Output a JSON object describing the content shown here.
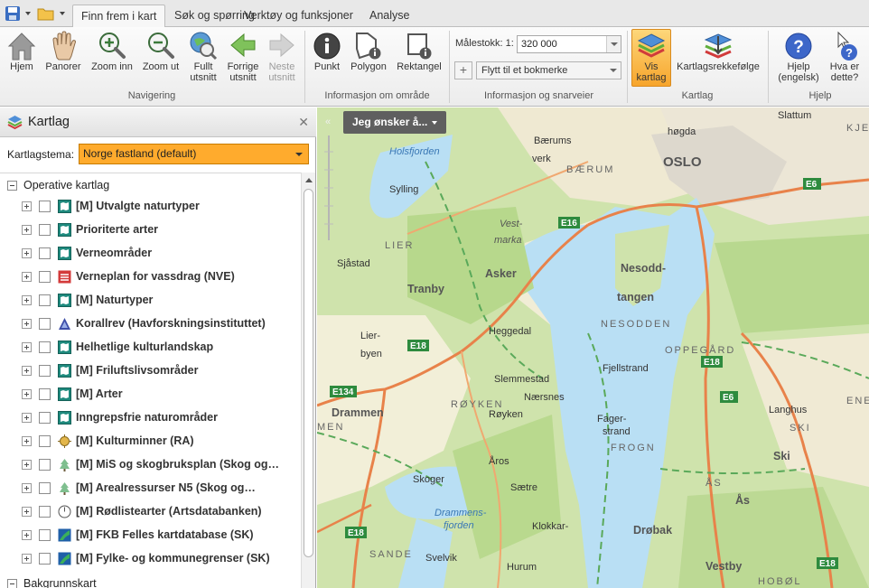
{
  "tabs": [
    "Finn frem i kart",
    "Søk og spørring",
    "Verktøy og funksjoner",
    "Analyse"
  ],
  "ribbon": {
    "nav_buttons": [
      {
        "label": "Hjem",
        "icon": "home-icon"
      },
      {
        "label": "Panorer",
        "icon": "pan-hand-icon"
      },
      {
        "label": "Zoom inn",
        "icon": "zoom-in-icon"
      },
      {
        "label": "Zoom ut",
        "icon": "zoom-out-icon"
      },
      {
        "label": "Fullt utsnitt",
        "icon": "full-extent-icon"
      },
      {
        "label": "Forrige utsnitt",
        "icon": "previous-extent-icon"
      },
      {
        "label": "Neste utsnitt",
        "icon": "next-extent-icon"
      }
    ],
    "nav_group_label": "Navigering",
    "info_buttons": [
      {
        "label": "Punkt",
        "icon": "info-point-icon"
      },
      {
        "label": "Polygon",
        "icon": "info-polygon-icon"
      },
      {
        "label": "Rektangel",
        "icon": "info-rectangle-icon"
      }
    ],
    "info_group_label": "Informasjon om område",
    "scale_label": "Målestokk: 1:",
    "scale_value": "320 000",
    "bookmark_placeholder": "Flytt til et bokmerke",
    "shortcut_group_label": "Informasjon og snarveier",
    "map_buttons": [
      {
        "label": "Vis kartlag",
        "icon": "layers-icon"
      },
      {
        "label": "Kartlagsrekkefølge",
        "icon": "layer-order-icon"
      }
    ],
    "map_group_label": "Kartlag",
    "help_buttons": [
      {
        "label": "Hjelp (engelsk)",
        "icon": "help-icon"
      },
      {
        "label": "Hva er dette?",
        "icon": "whats-this-icon"
      }
    ],
    "help_group_label": "Hjelp"
  },
  "panel": {
    "title": "Kartlag",
    "theme_label": "Kartlagstema:",
    "theme_value": "Norge fastland (default)",
    "section_operative": "Operative kartlag",
    "section_background": "Bakgrunnskart",
    "layers": [
      {
        "label": "[M] Utvalgte naturtyper",
        "icon": "map-service-icon"
      },
      {
        "label": "Prioriterte arter",
        "icon": "map-service-icon"
      },
      {
        "label": "Verneområder",
        "icon": "map-service-icon"
      },
      {
        "label": "Verneplan for vassdrag (NVE)",
        "icon": "nve-icon"
      },
      {
        "label": "[M] Naturtyper",
        "icon": "map-service-icon"
      },
      {
        "label": "Korallrev (Havforskningsinstituttet)",
        "icon": "imr-icon"
      },
      {
        "label": "Helhetlige kulturlandskap",
        "icon": "map-service-icon"
      },
      {
        "label": "[M] Friluftslivsområder",
        "icon": "map-service-icon"
      },
      {
        "label": "[M] Arter",
        "icon": "map-service-icon"
      },
      {
        "label": "Inngrepsfrie naturområder",
        "icon": "map-service-icon"
      },
      {
        "label": "[M] Kulturminner (RA)",
        "icon": "ra-icon"
      },
      {
        "label": "[M] MiS og skogbruksplan (Skog og…",
        "icon": "tree-icon"
      },
      {
        "label": "[M] Arealressurser N5 (Skog og…",
        "icon": "tree-icon"
      },
      {
        "label": "[M] Rødlistearter (Artsdatabanken)",
        "icon": "artsdatabanken-icon"
      },
      {
        "label": "[M] FKB Felles kartdatabase (SK)",
        "icon": "sk-icon"
      },
      {
        "label": "[M] Fylke- og kommunegrenser (SK)",
        "icon": "sk-icon"
      }
    ]
  },
  "map": {
    "action_button": "Jeg ønsker å...",
    "collapse_label": "«",
    "labels": {
      "oslo": "OSLO",
      "baerum_city": "Bærums",
      "verk": "verk",
      "baerum": "BÆRUM",
      "holsfjorden": "Holsfjorden",
      "sylling": "Sylling",
      "lier": "LIER",
      "vestmarka1": "Vest-",
      "vestmarka2": "marka",
      "sjastad": "Sjåstad",
      "asker": "Asker",
      "tranby": "Tranby",
      "nesodd1": "Nesodd-",
      "nesodd2": "tangen",
      "nesodden": "NESODDEN",
      "heggedal": "Heggedal",
      "lier_byen1": "Lier-",
      "lier_byen2": "byen",
      "oppegard": "OPPEGÅRD",
      "fjellstrand": "Fjellstrand",
      "slemmestad": "Slemmestad",
      "naersnes": "Nærsnes",
      "royken": "RØYKEN",
      "royken_town": "Røyken",
      "drammen": "Drammen",
      "men": "MEN",
      "fager1": "Fager-",
      "fager2": "strand",
      "frogn": "FROGN",
      "langhus": "Langhus",
      "ski_region": "SKI",
      "ski": "Ski",
      "aros": "Åros",
      "saetre": "Sætre",
      "skoger": "Skoger",
      "drammensfjorden1": "Drammens-",
      "drammensfjorden2": "fjorden",
      "klokkar": "Klokkar-",
      "drobak": "Drøbak",
      "as": "Ås",
      "as_region": "ÅS",
      "sande": "SANDE",
      "svelvik": "Svelvik",
      "hurum": "Hurum",
      "vestby": "Vestby",
      "hobol": "HOBØL",
      "slattum": "Slattum",
      "kjelsas": "KJE",
      "hogda": "høgda",
      "ene": "ENE",
      "e6": "E6",
      "e16": "E16",
      "e18": "E18",
      "e134": "E134"
    }
  }
}
